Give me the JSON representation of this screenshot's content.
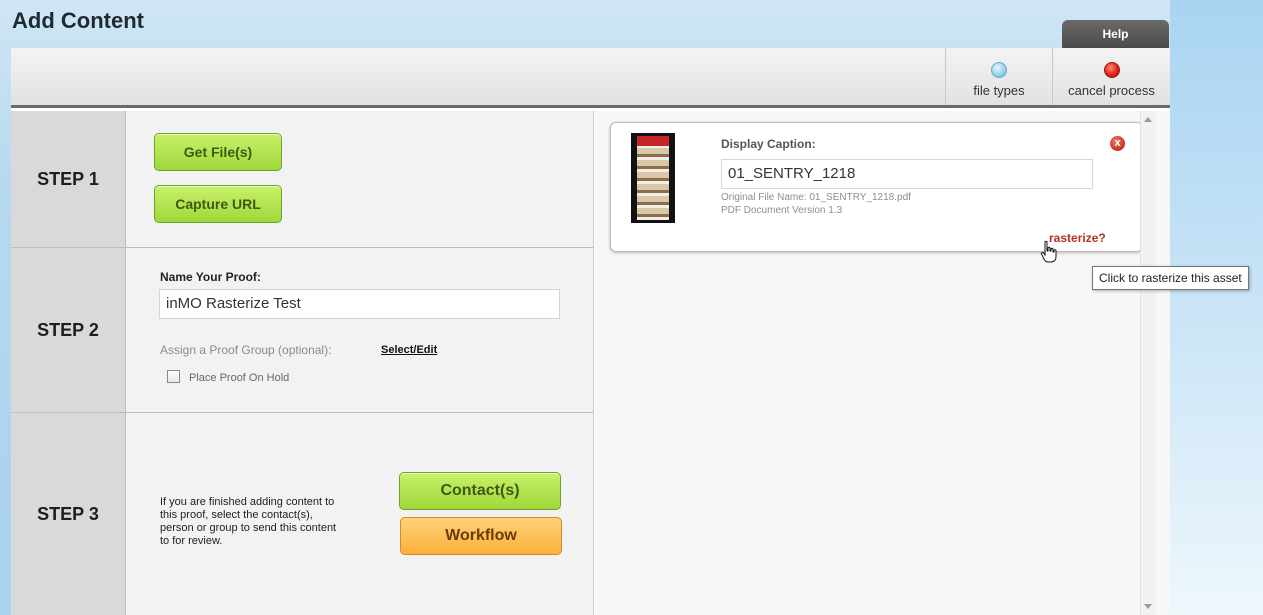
{
  "page": {
    "title": "Add Content",
    "help_label": "Help"
  },
  "toolbar": {
    "file_types_label": "file types",
    "cancel_process_label": "cancel process"
  },
  "step1": {
    "label": "STEP 1",
    "get_files_label": "Get File(s)",
    "capture_url_label": "Capture URL"
  },
  "step2": {
    "label": "STEP 2",
    "name_proof_label": "Name Your Proof:",
    "proof_name_value": "inMO Rasterize Test",
    "proof_group_label": "Assign a Proof Group (optional):",
    "select_edit_label": "Select/Edit",
    "place_on_hold_label": "Place Proof On Hold"
  },
  "step3": {
    "label": "STEP 3",
    "instructions_lines": [
      "If you are finished adding content to",
      "this proof, select the contact(s),",
      "person or group to send this content",
      "to for review."
    ],
    "contacts_label": "Contact(s)",
    "workflow_label": "Workflow"
  },
  "asset": {
    "caption_label": "Display Caption:",
    "caption_value": "01_SENTRY_1218",
    "original_file_name": "Original File Name: 01_SENTRY_1218.pdf",
    "document_version": "PDF Document Version 1.3",
    "rasterize_label": "rasterize?",
    "close_symbol": "x"
  },
  "tooltip": {
    "text": "Click to rasterize this asset"
  },
  "icons": {
    "file_types": "blue-dot-icon",
    "cancel_process": "red-dot-icon",
    "remove_asset": "close-icon",
    "pointer": "hand-cursor-icon"
  },
  "colors": {
    "green_button": "#9fd83a",
    "orange_button": "#fbb03b",
    "rasterize_link": "#b6301d"
  }
}
